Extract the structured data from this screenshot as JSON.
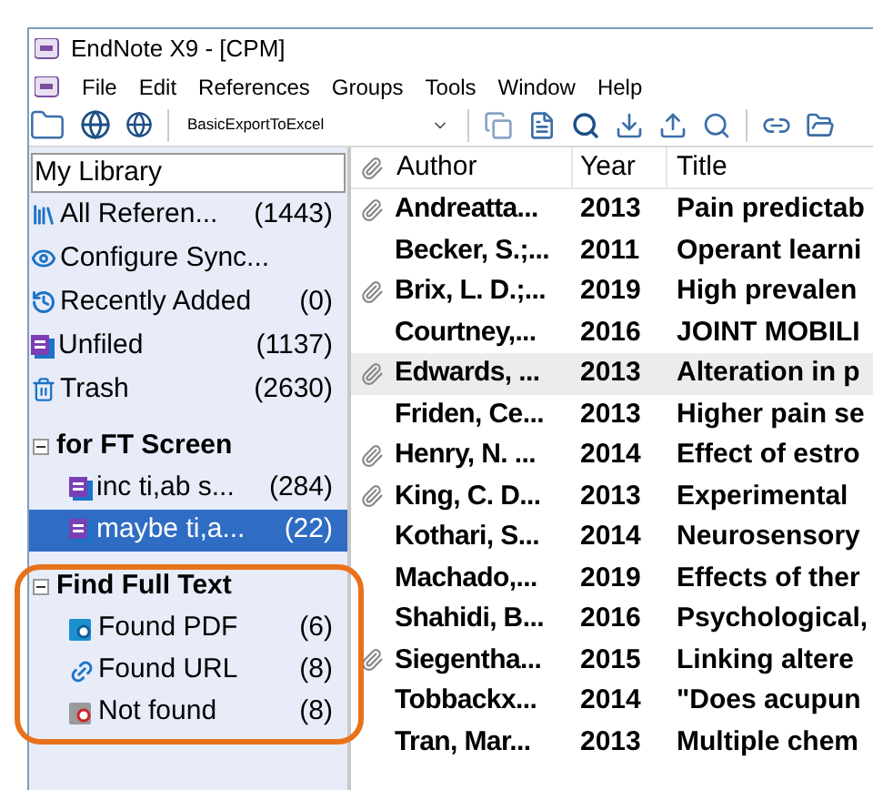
{
  "window": {
    "title": "EndNote X9 - [CPM]"
  },
  "menu": [
    "File",
    "Edit",
    "References",
    "Groups",
    "Tools",
    "Window",
    "Help"
  ],
  "toolbar": {
    "style_dropdown": "BasicExportToExcel"
  },
  "sidebar": {
    "header": "My Library",
    "items": [
      {
        "kind": "all",
        "label": "All Referen...",
        "count": "(1443)"
      },
      {
        "kind": "sync",
        "label": "Configure Sync..."
      },
      {
        "kind": "recent",
        "label": "Recently Added",
        "count": "(0)"
      },
      {
        "kind": "unfiled",
        "label": "Unfiled",
        "count": "(1137)"
      },
      {
        "kind": "trash",
        "label": "Trash",
        "count": "(2630)"
      }
    ],
    "groups": [
      {
        "title": "for FT Screen",
        "expanded": true,
        "highlighted": false,
        "items": [
          {
            "kind": "group",
            "label": "inc ti,ab s...",
            "count": "(284)",
            "selected": false
          },
          {
            "kind": "group",
            "label": "maybe ti,a...",
            "count": "(22)",
            "selected": true
          }
        ]
      },
      {
        "title": "Find Full Text",
        "expanded": true,
        "highlighted": true,
        "items": [
          {
            "kind": "found_pdf",
            "label": "Found PDF",
            "count": "(6)",
            "selected": false
          },
          {
            "kind": "found_url",
            "label": "Found URL",
            "count": "(8)",
            "selected": false
          },
          {
            "kind": "not_found",
            "label": "Not found",
            "count": "(8)",
            "selected": false
          }
        ]
      }
    ]
  },
  "table": {
    "columns": [
      "Author",
      "Year",
      "Title"
    ],
    "rows": [
      {
        "attachment": true,
        "selected": false,
        "author": "Andreatta...",
        "year": "2013",
        "title": "Pain predictab"
      },
      {
        "attachment": false,
        "selected": false,
        "author": "Becker, S.;...",
        "year": "2011",
        "title": "Operant learni"
      },
      {
        "attachment": true,
        "selected": false,
        "author": "Brix, L. D.;...",
        "year": "2019",
        "title": "High prevalen"
      },
      {
        "attachment": false,
        "selected": false,
        "author": "Courtney,...",
        "year": "2016",
        "title": "JOINT MOBILI"
      },
      {
        "attachment": true,
        "selected": true,
        "author": "Edwards, ...",
        "year": "2013",
        "title": "Alteration in p"
      },
      {
        "attachment": false,
        "selected": false,
        "author": "Friden, Ce...",
        "year": "2013",
        "title": "Higher pain se"
      },
      {
        "attachment": true,
        "selected": false,
        "author": "Henry, N. ...",
        "year": "2014",
        "title": "Effect of estro"
      },
      {
        "attachment": true,
        "selected": false,
        "author": "King, C. D...",
        "year": "2013",
        "title": "Experimental"
      },
      {
        "attachment": false,
        "selected": false,
        "author": "Kothari, S...",
        "year": "2014",
        "title": "Neurosensory"
      },
      {
        "attachment": false,
        "selected": false,
        "author": "Machado,...",
        "year": "2019",
        "title": "Effects of ther"
      },
      {
        "attachment": false,
        "selected": false,
        "author": "Shahidi, B...",
        "year": "2016",
        "title": "Psychological,"
      },
      {
        "attachment": true,
        "selected": false,
        "author": "Siegentha...",
        "year": "2015",
        "title": "Linking altere"
      },
      {
        "attachment": false,
        "selected": false,
        "author": "Tobbackx...",
        "year": "2014",
        "title": "\"Does acupun"
      },
      {
        "attachment": false,
        "selected": false,
        "author": "Tran, Mar...",
        "year": "2013",
        "title": "Multiple chem"
      }
    ]
  }
}
